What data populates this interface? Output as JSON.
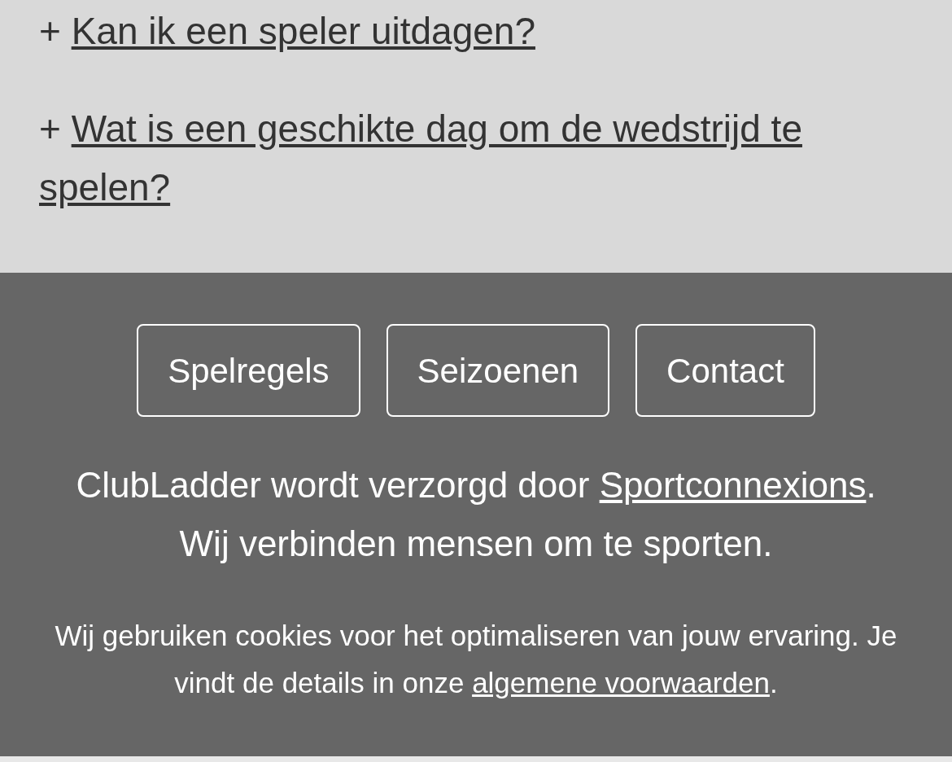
{
  "faq": [
    {
      "marker": "+",
      "question": "Kan ik een speler uitdagen?"
    },
    {
      "marker": "+",
      "question": "Wat is een geschikte dag om de wedstrijd te spelen?"
    }
  ],
  "footer": {
    "buttons": [
      "Spelregels",
      "Seizoenen",
      "Contact"
    ],
    "credit": {
      "before": "ClubLadder wordt verzorgd door ",
      "link": "Sportconnexions",
      "after": "."
    },
    "tagline": "Wij verbinden mensen om te sporten.",
    "cookie": {
      "before": "Wij gebruiken cookies voor het optimaliseren van jouw ervaring. Je vindt de details in onze ",
      "link": "algemene voorwaarden",
      "after": "."
    }
  }
}
